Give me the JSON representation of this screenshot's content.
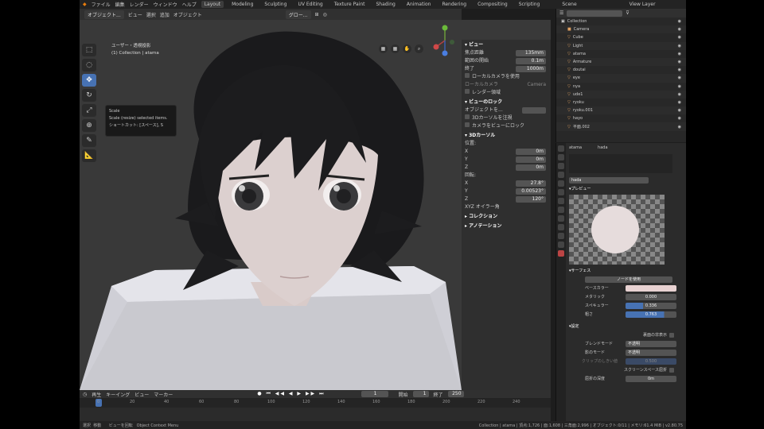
{
  "topbar": {
    "menus": [
      "ファイル",
      "編集",
      "レンダー",
      "ウィンドウ",
      "ヘルプ"
    ],
    "workspaces": [
      "Layout",
      "Modeling",
      "Sculpting",
      "UV Editing",
      "Texture Paint",
      "Shading",
      "Animation",
      "Rendering",
      "Compositing",
      "Scripting"
    ],
    "active_workspace": "Layout",
    "scene": "Scene",
    "view_layer": "View Layer"
  },
  "viewport_header": {
    "mode": "オブジェクト...",
    "menus": [
      "ビュー",
      "選択",
      "追加",
      "オブジェクト"
    ],
    "transform": "グロー..."
  },
  "viewport": {
    "view_name": "ユーザー・透視投影",
    "collection_info": "(1) Collection | atama"
  },
  "tooltip": {
    "title": "Scale",
    "desc": "Scale (resize) selected items.",
    "shortcut": "ショートカット: [スペース], S"
  },
  "npanel": {
    "view_section": "ビュー",
    "focal_label": "焦点距離",
    "focal_value": "135mm",
    "clip_start_label": "範囲の開始",
    "clip_start_value": "0.1m",
    "clip_end_label": "終了",
    "clip_end_value": "1000m",
    "local_camera_label": "ローカルカメラを使用",
    "local_camera2_label": "ローカルカメラ",
    "local_camera_value": "Camera",
    "render_region_label": "レンダー領域",
    "view_lock_section": "ビューのロック",
    "lock_object_label": "オブジェクトを...",
    "lock_cursor_label": "3Dカーソルを注視",
    "camera_view_lock_label": "カメラをビューにロック",
    "cursor_section": "3Dカーソル",
    "location_label": "位置:",
    "loc_x": "0m",
    "loc_y": "0m",
    "loc_z": "0m",
    "rotation_label": "回転:",
    "rot_x": "27.8°",
    "rot_y": "0.00523°",
    "rot_z": "120°",
    "rotation_mode": "XYZ オイラー角",
    "collection_section": "コレクション",
    "annotation_section": "アノテーション"
  },
  "timeline": {
    "menus": [
      "再生",
      "キーイング",
      "ビュー",
      "マーカー"
    ],
    "current_frame": "1",
    "start_label": "開始",
    "start": "1",
    "end_label": "終了",
    "end": "250",
    "ticks": [
      "0",
      "20",
      "40",
      "60",
      "80",
      "100",
      "120",
      "140",
      "160",
      "180",
      "200",
      "220",
      "240"
    ]
  },
  "status": {
    "left": "選択",
    "left2": "移動",
    "middle": "ビューを回転",
    "middle2": "Object Context Menu",
    "right": "Collection | atama | 頂点:1,726 | 面:1,608 | 三角面:2,996 | オブジェクト:0/11 | メモリ:61.4 MiB | v2.80.75"
  },
  "outliner": {
    "items": [
      {
        "name": "Collection",
        "type": "collection"
      },
      {
        "name": "Camera",
        "type": "camera"
      },
      {
        "name": "Cube",
        "type": "mesh"
      },
      {
        "name": "Light",
        "type": "light"
      },
      {
        "name": "atama",
        "type": "mesh"
      },
      {
        "name": "Armature",
        "type": "armature"
      },
      {
        "name": "doutai",
        "type": "mesh"
      },
      {
        "name": "eye",
        "type": "mesh"
      },
      {
        "name": "nya",
        "type": "mesh"
      },
      {
        "name": "ude1",
        "type": "mesh"
      },
      {
        "name": "ryoku",
        "type": "mesh"
      },
      {
        "name": "ryoku.001",
        "type": "mesh"
      },
      {
        "name": "hayo",
        "type": "mesh"
      },
      {
        "name": "平面.002",
        "type": "mesh"
      }
    ]
  },
  "properties": {
    "object_name": "atama",
    "material_name": "hada",
    "material_field": "hada",
    "preview_label": "プレビュー",
    "surface_label": "サーフェス",
    "use_nodes": "ノードを使用",
    "base_color_label": "ベースカラー",
    "metallic_label": "メタリック",
    "metallic_value": "0.000",
    "specular_label": "スペキュラー",
    "specular_value": "0.336",
    "roughness_label": "粗さ",
    "roughness_value": "0.763",
    "settings_label": "設定",
    "backface_label": "裏面の非表示",
    "blend_mode_label": "ブレンドモード",
    "blend_mode_value": "不透明",
    "shadow_mode_label": "影のモード",
    "shadow_mode_value": "不透明",
    "clip_label": "クリップのしきい値",
    "clip_value": "0.500",
    "screen_space_label": "スクリーンスペース屈折",
    "refraction_depth_label": "屈折の深度",
    "refraction_depth_value": "0m",
    "base_color": "#e8d2d2",
    "accent": "#4772b3"
  }
}
